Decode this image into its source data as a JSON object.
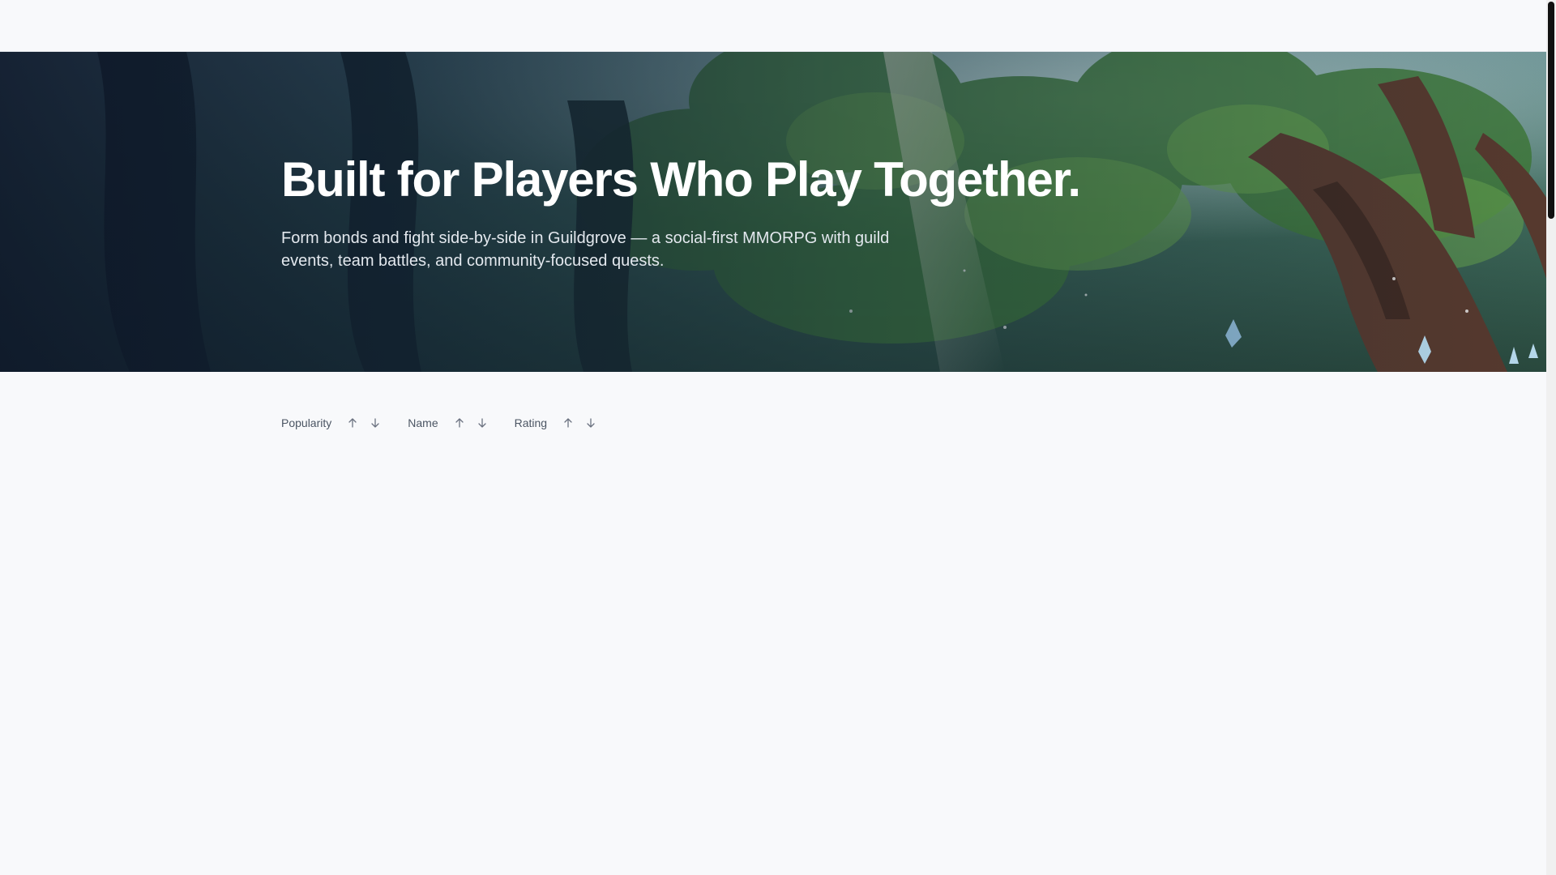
{
  "hero": {
    "title": "Built for Players Who Play Together.",
    "subtitle": "Form bonds and fight side-by-side in Guildgrove — a social-first MMORPG with guild events, team battles, and community-focused quests.",
    "background": "forest-scene-image"
  },
  "sort": {
    "options": [
      {
        "label": "Popularity",
        "asc_icon": "arrow-up-icon",
        "desc_icon": "arrow-down-icon"
      },
      {
        "label": "Name",
        "asc_icon": "arrow-up-icon",
        "desc_icon": "arrow-down-icon"
      },
      {
        "label": "Rating",
        "asc_icon": "arrow-up-icon",
        "desc_icon": "arrow-down-icon"
      }
    ]
  },
  "colors": {
    "page_background": "#f8f9fb",
    "hero_title": "#ffffff",
    "hero_subtitle": "#e3e8ee",
    "sort_text": "#4b5563",
    "sort_icon": "#6b7280",
    "scroll_thumb": "#111111"
  }
}
